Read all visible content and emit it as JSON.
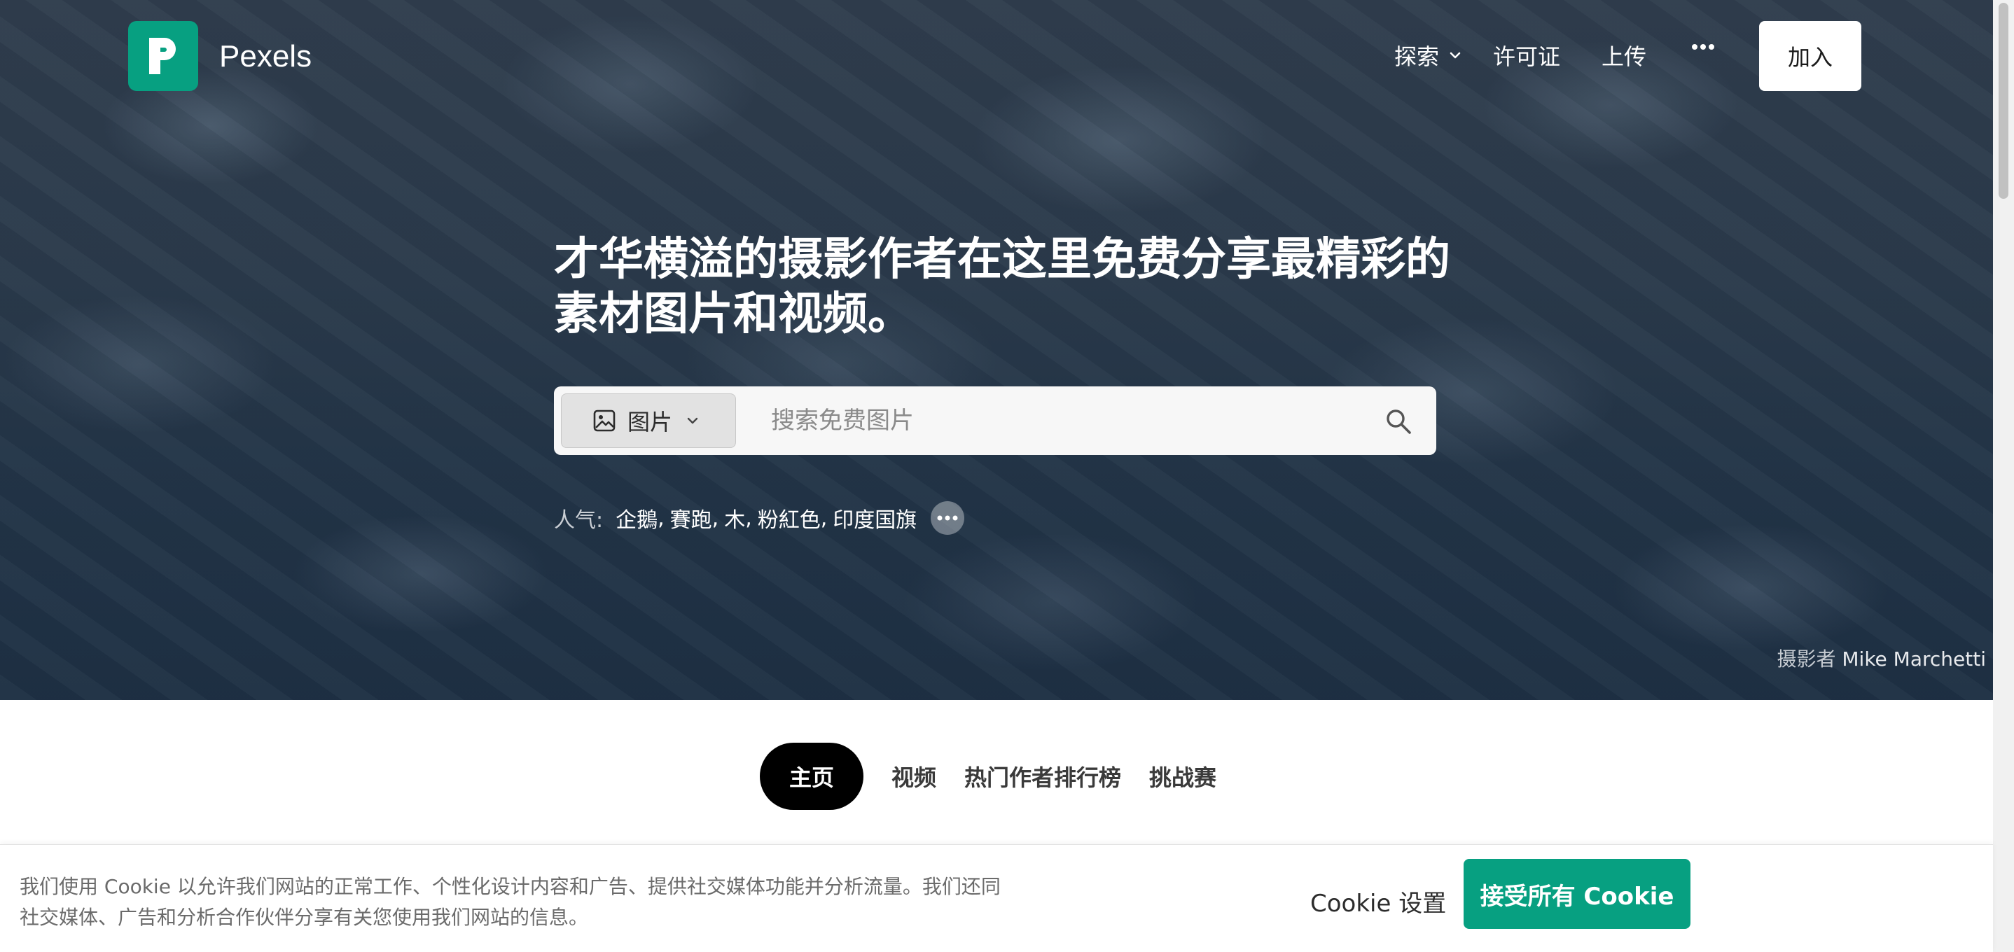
{
  "header": {
    "brand": "Pexels",
    "nav": {
      "explore": "探索",
      "license": "许可证",
      "upload": "上传",
      "join": "加入"
    }
  },
  "hero": {
    "headline": "才华横溢的摄影作者在这里免费分享最精彩的素材图片和视频。",
    "search": {
      "type_label": "图片",
      "placeholder": "搜索免费图片"
    },
    "popular": {
      "label": "人气:",
      "tags": [
        "企鵝",
        "賽跑",
        "木",
        "粉紅色",
        "印度国旗"
      ]
    },
    "credit": {
      "prefix": "摄影者",
      "name": "Mike Marchetti"
    }
  },
  "tabs": [
    {
      "label": "主页",
      "active": true
    },
    {
      "label": "视频",
      "active": false
    },
    {
      "label": "热门作者排行榜",
      "active": false
    },
    {
      "label": "挑战赛",
      "active": false
    }
  ],
  "cookie": {
    "text": "我们使用 Cookie 以允许我们网站的正常工作、个性化设计内容和广告、提供社交媒体功能并分析流量。我们还同社交媒体、广告和分析合作伙伴分享有关您使用我们网站的信息。",
    "settings_label": "Cookie 设置",
    "accept_label": "接受所有 Cookie"
  },
  "colors": {
    "brand_green": "#07a081",
    "tab_active_bg": "#000000"
  }
}
